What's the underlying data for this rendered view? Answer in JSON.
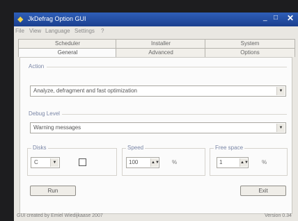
{
  "window": {
    "title": "JkDefrag Option GUI",
    "icons": {
      "app": "defrag-app-icon",
      "minimize": "minimize-icon",
      "maximize": "maximize-icon",
      "close": "close-icon"
    },
    "glyphs": {
      "app": "◆",
      "minimize": "_",
      "maximize": "□",
      "close": "✕"
    }
  },
  "menu": [
    "File",
    "View",
    "Language",
    "Settings",
    "?"
  ],
  "tabs_top": [
    "Scheduler",
    "Installer",
    "System"
  ],
  "tabs_bottom": [
    "General",
    "Advanced",
    "Options"
  ],
  "active_tab": "General",
  "action": {
    "label": "Action",
    "value": "Analyze, defragment and fast optimization"
  },
  "debug": {
    "label": "Debug Level",
    "value": "Warning messages"
  },
  "disks": {
    "label": "Disks",
    "value": "C"
  },
  "speed": {
    "label": "Speed",
    "value": "100",
    "unit": "%"
  },
  "freespace": {
    "label": "Free space",
    "value": "1",
    "unit": "%"
  },
  "buttons": {
    "run": "Run",
    "exit": "Exit"
  },
  "status": {
    "left": "GUI created by Emiel Wiedijkaase 2007",
    "right": "Version 0.34"
  },
  "colors": {
    "titlebar": "#2f5fb8",
    "group_label": "#7a86a6"
  }
}
